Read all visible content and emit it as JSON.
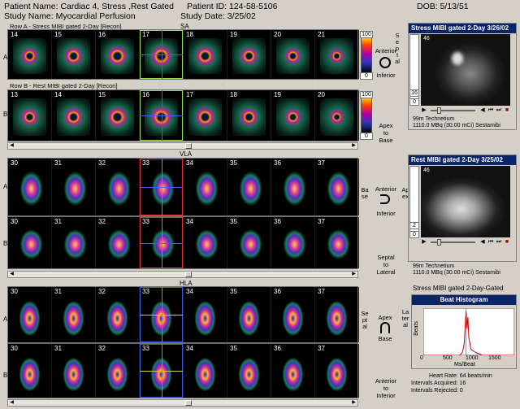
{
  "header": {
    "patient_name": "Patient Name: Cardiac 4, Stress ,Rest Gated",
    "patient_id": "Patient ID: 124-58-5106",
    "dob": "DOB: 5/13/51",
    "study_name": "Study Name: Myocardial Perfusion",
    "study_date": "Study Date: 3/25/02"
  },
  "sa": {
    "row_a_title": "Row A - Stress MIBI gated 2-Day [Recon]",
    "row_b_title": "Row B - Rest MIBI gated 2-Day [Recon]",
    "label": "SA",
    "row_a": "A",
    "row_b": "B",
    "row_a_nums": [
      "14",
      "15",
      "16",
      "17",
      "18",
      "19",
      "20",
      "21"
    ],
    "row_b_nums": [
      "13",
      "14",
      "15",
      "16",
      "17",
      "18",
      "19",
      "20"
    ],
    "cb_top": "100",
    "cb_bottom": "0",
    "cb_top2": "100",
    "cb_bottom2": "0"
  },
  "vla": {
    "label": "VLA",
    "row_a": "A",
    "row_b": "B",
    "row_a_nums": [
      "30",
      "31",
      "32",
      "33",
      "34",
      "35",
      "36",
      "37"
    ],
    "row_b_nums": [
      "30",
      "31",
      "32",
      "33",
      "34",
      "35",
      "36",
      "37"
    ]
  },
  "hla": {
    "label": "HLA",
    "row_a": "A",
    "row_b": "B",
    "row_a_nums": [
      "30",
      "31",
      "32",
      "33",
      "34",
      "35",
      "36",
      "37"
    ],
    "row_b_nums": [
      "30",
      "31",
      "32",
      "33",
      "34",
      "35",
      "36",
      "37"
    ]
  },
  "orient": {
    "anterior": "Anterior",
    "inferior": "Inferior",
    "septal": "Septal",
    "lateral": "Lateral",
    "apex_to_base": "Apex\nto\nBase",
    "base": "Base",
    "apex": "Apex",
    "septal_to_lateral": "Septal\nto\nLateral",
    "anterior_to_inferior": "Anterior\nto\nInferior"
  },
  "stress_panel": {
    "title": "Stress MIBI gated 2-Day 3/26/02",
    "frame": "46",
    "ctrl1": "16",
    "ctrl2": "0",
    "isotope": "99m Technetium",
    "dose": "1110.0 MBq (30.00 mCi) Sestamibi"
  },
  "rest_panel": {
    "title": "Rest MIBI gated 2-Day 3/25/02",
    "frame": "46",
    "ctrl1": "2",
    "ctrl2": "0",
    "isotope": "99m Technetium",
    "dose": "1110.0 MBq (30.00 mCi) Sestamibi"
  },
  "gated_label": "Stress MIBI gated 2-Day-Gated",
  "histogram": {
    "title": "Beat Histogram",
    "ylabel": "Beats",
    "xlabel": "Ms/Beat",
    "ticks": [
      "0",
      "500",
      "1000",
      "1500"
    ],
    "heart_rate": "Heart Rate: 64 beats/min",
    "acquired": "Intervals Acquired: 16",
    "rejected": "Intervals Rejected: 0"
  },
  "chart_data": {
    "type": "line",
    "title": "Beat Histogram",
    "xlabel": "Ms/Beat",
    "ylabel": "Beats",
    "xlim": [
      0,
      2000
    ],
    "x": [
      0,
      600,
      800,
      860,
      900,
      920,
      940,
      960,
      980,
      1000,
      1050,
      1150,
      1300,
      1600,
      2000
    ],
    "series": [
      {
        "values": [
          0,
          0,
          0,
          1,
          4,
          10,
          15,
          9,
          13,
          6,
          2,
          1,
          0,
          0,
          0
        ]
      }
    ]
  }
}
